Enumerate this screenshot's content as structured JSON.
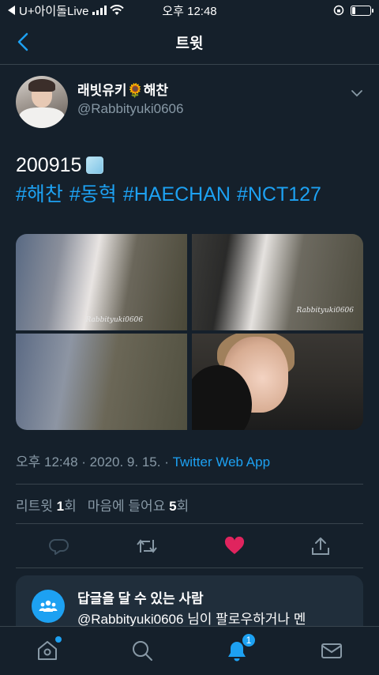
{
  "status_bar": {
    "carrier": "U+아이돌Live",
    "time": "오후 12:48",
    "battery_level": 0.2
  },
  "header": {
    "title": "트윗"
  },
  "tweet": {
    "display_name": "래빗유키🌻해찬",
    "handle": "@Rabbityuki0606",
    "text": "200915",
    "hashtags": [
      "#해찬",
      "#동혁",
      "#HAECHAN",
      "#NCT127"
    ],
    "photo_watermark": "Rabbityuki0606",
    "meta": {
      "time": "오후 12:48",
      "sep1": " · ",
      "date": "2020. 9. 15.",
      "sep2": " · ",
      "source": "Twitter Web App"
    },
    "stats": {
      "retweet_label": "리트윗",
      "retweet_count": "1",
      "retweet_unit": "회",
      "like_label": "마음에 들어요",
      "like_count": "5",
      "like_unit": "회"
    }
  },
  "reply_restriction": {
    "title": "답글을 달 수 있는 사람",
    "description": "@Rabbityuki0606 님이 팔로우하거나 멘"
  },
  "tab_bar": {
    "notification_badge": "1"
  },
  "colors": {
    "background": "#15202b",
    "accent": "#1da1f2",
    "muted": "#8899a6",
    "like": "#e0245e"
  }
}
